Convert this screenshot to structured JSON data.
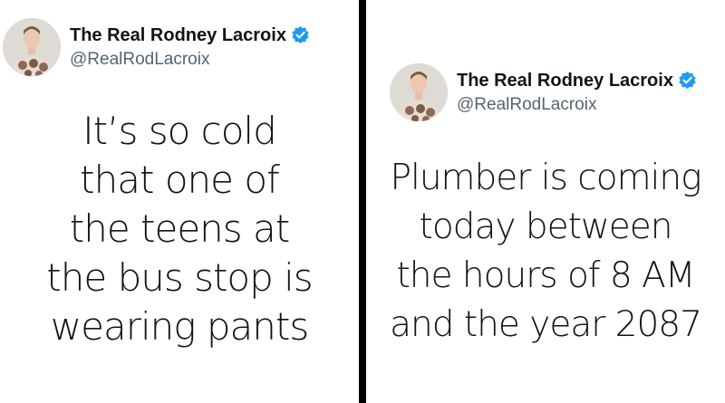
{
  "posts": [
    {
      "author": {
        "display_name": "The Real Rodney Lacroix",
        "handle": "@RealRodLacroix",
        "verified": true,
        "badge_color": "#1d9bf0"
      },
      "text_lines": [
        "It’s so cold",
        "that one of",
        "the teens at",
        "the bus stop is",
        "wearing pants"
      ]
    },
    {
      "author": {
        "display_name": "The Real Rodney Lacroix",
        "handle": "@RealRodLacroix",
        "verified": true,
        "badge_color": "#1d9bf0"
      },
      "text_lines": [
        "Plumber is coming",
        "today between",
        "the hours of 8 AM",
        "and the year 2087"
      ]
    }
  ]
}
